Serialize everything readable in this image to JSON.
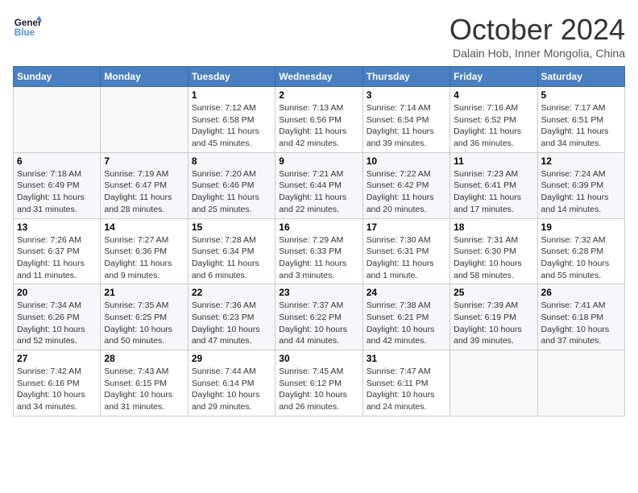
{
  "header": {
    "logo_line1": "General",
    "logo_line2": "Blue",
    "title": "October 2024",
    "subtitle": "Dalain Hob, Inner Mongolia, China"
  },
  "days_of_week": [
    "Sunday",
    "Monday",
    "Tuesday",
    "Wednesday",
    "Thursday",
    "Friday",
    "Saturday"
  ],
  "weeks": [
    [
      {
        "num": "",
        "info": ""
      },
      {
        "num": "",
        "info": ""
      },
      {
        "num": "1",
        "info": "Sunrise: 7:12 AM\nSunset: 6:58 PM\nDaylight: 11 hours and 45 minutes."
      },
      {
        "num": "2",
        "info": "Sunrise: 7:13 AM\nSunset: 6:56 PM\nDaylight: 11 hours and 42 minutes."
      },
      {
        "num": "3",
        "info": "Sunrise: 7:14 AM\nSunset: 6:54 PM\nDaylight: 11 hours and 39 minutes."
      },
      {
        "num": "4",
        "info": "Sunrise: 7:16 AM\nSunset: 6:52 PM\nDaylight: 11 hours and 36 minutes."
      },
      {
        "num": "5",
        "info": "Sunrise: 7:17 AM\nSunset: 6:51 PM\nDaylight: 11 hours and 34 minutes."
      }
    ],
    [
      {
        "num": "6",
        "info": "Sunrise: 7:18 AM\nSunset: 6:49 PM\nDaylight: 11 hours and 31 minutes."
      },
      {
        "num": "7",
        "info": "Sunrise: 7:19 AM\nSunset: 6:47 PM\nDaylight: 11 hours and 28 minutes."
      },
      {
        "num": "8",
        "info": "Sunrise: 7:20 AM\nSunset: 6:46 PM\nDaylight: 11 hours and 25 minutes."
      },
      {
        "num": "9",
        "info": "Sunrise: 7:21 AM\nSunset: 6:44 PM\nDaylight: 11 hours and 22 minutes."
      },
      {
        "num": "10",
        "info": "Sunrise: 7:22 AM\nSunset: 6:42 PM\nDaylight: 11 hours and 20 minutes."
      },
      {
        "num": "11",
        "info": "Sunrise: 7:23 AM\nSunset: 6:41 PM\nDaylight: 11 hours and 17 minutes."
      },
      {
        "num": "12",
        "info": "Sunrise: 7:24 AM\nSunset: 6:39 PM\nDaylight: 11 hours and 14 minutes."
      }
    ],
    [
      {
        "num": "13",
        "info": "Sunrise: 7:26 AM\nSunset: 6:37 PM\nDaylight: 11 hours and 11 minutes."
      },
      {
        "num": "14",
        "info": "Sunrise: 7:27 AM\nSunset: 6:36 PM\nDaylight: 11 hours and 9 minutes."
      },
      {
        "num": "15",
        "info": "Sunrise: 7:28 AM\nSunset: 6:34 PM\nDaylight: 11 hours and 6 minutes."
      },
      {
        "num": "16",
        "info": "Sunrise: 7:29 AM\nSunset: 6:33 PM\nDaylight: 11 hours and 3 minutes."
      },
      {
        "num": "17",
        "info": "Sunrise: 7:30 AM\nSunset: 6:31 PM\nDaylight: 11 hours and 1 minute."
      },
      {
        "num": "18",
        "info": "Sunrise: 7:31 AM\nSunset: 6:30 PM\nDaylight: 10 hours and 58 minutes."
      },
      {
        "num": "19",
        "info": "Sunrise: 7:32 AM\nSunset: 6:28 PM\nDaylight: 10 hours and 55 minutes."
      }
    ],
    [
      {
        "num": "20",
        "info": "Sunrise: 7:34 AM\nSunset: 6:26 PM\nDaylight: 10 hours and 52 minutes."
      },
      {
        "num": "21",
        "info": "Sunrise: 7:35 AM\nSunset: 6:25 PM\nDaylight: 10 hours and 50 minutes."
      },
      {
        "num": "22",
        "info": "Sunrise: 7:36 AM\nSunset: 6:23 PM\nDaylight: 10 hours and 47 minutes."
      },
      {
        "num": "23",
        "info": "Sunrise: 7:37 AM\nSunset: 6:22 PM\nDaylight: 10 hours and 44 minutes."
      },
      {
        "num": "24",
        "info": "Sunrise: 7:38 AM\nSunset: 6:21 PM\nDaylight: 10 hours and 42 minutes."
      },
      {
        "num": "25",
        "info": "Sunrise: 7:39 AM\nSunset: 6:19 PM\nDaylight: 10 hours and 39 minutes."
      },
      {
        "num": "26",
        "info": "Sunrise: 7:41 AM\nSunset: 6:18 PM\nDaylight: 10 hours and 37 minutes."
      }
    ],
    [
      {
        "num": "27",
        "info": "Sunrise: 7:42 AM\nSunset: 6:16 PM\nDaylight: 10 hours and 34 minutes."
      },
      {
        "num": "28",
        "info": "Sunrise: 7:43 AM\nSunset: 6:15 PM\nDaylight: 10 hours and 31 minutes."
      },
      {
        "num": "29",
        "info": "Sunrise: 7:44 AM\nSunset: 6:14 PM\nDaylight: 10 hours and 29 minutes."
      },
      {
        "num": "30",
        "info": "Sunrise: 7:45 AM\nSunset: 6:12 PM\nDaylight: 10 hours and 26 minutes."
      },
      {
        "num": "31",
        "info": "Sunrise: 7:47 AM\nSunset: 6:11 PM\nDaylight: 10 hours and 24 minutes."
      },
      {
        "num": "",
        "info": ""
      },
      {
        "num": "",
        "info": ""
      }
    ]
  ]
}
